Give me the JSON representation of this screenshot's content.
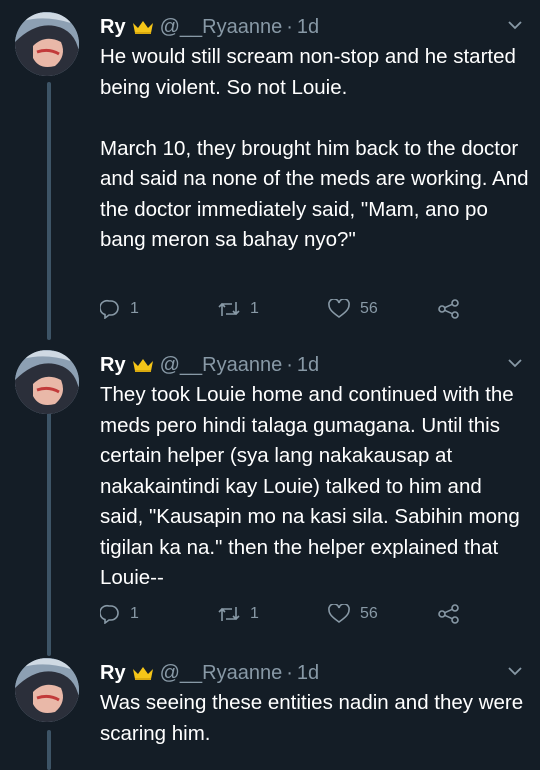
{
  "tweets": [
    {
      "name": "Ry",
      "handle": "@__Ryaanne",
      "separator": "·",
      "time": "1d",
      "text": "He would still scream non-stop and he started being violent. So not Louie.\n\nMarch 10, they brought him back to the doctor and said na none of the meds are working. And the doctor immediately said, \"Mam, ano po bang meron sa bahay nyo?\"",
      "replies": "1",
      "retweets": "1",
      "likes": "56"
    },
    {
      "name": "Ry",
      "handle": "@__Ryaanne",
      "separator": "·",
      "time": "1d",
      "text": "They took Louie home and continued with the meds pero hindi talaga gumagana. Until this certain helper (sya lang nakakausap at nakakaintindi kay Louie) talked to him and said, \"Kausapin mo na kasi sila. Sabihin mong tigilan ka na.\" then the helper explained that Louie--",
      "replies": "1",
      "retweets": "1",
      "likes": "56"
    },
    {
      "name": "Ry",
      "handle": "@__Ryaanne",
      "separator": "·",
      "time": "1d",
      "text": "Was seeing these entities nadin and they were scaring him."
    }
  ],
  "icons": {
    "crown": "crown-icon",
    "caret": "chevron-down-icon",
    "reply": "reply-icon",
    "retweet": "retweet-icon",
    "like": "heart-icon",
    "share": "share-icon"
  },
  "colors": {
    "background": "#141d26",
    "muted_text": "#8899a6",
    "thread_line": "#3d5466",
    "crown": "#f5c518"
  }
}
